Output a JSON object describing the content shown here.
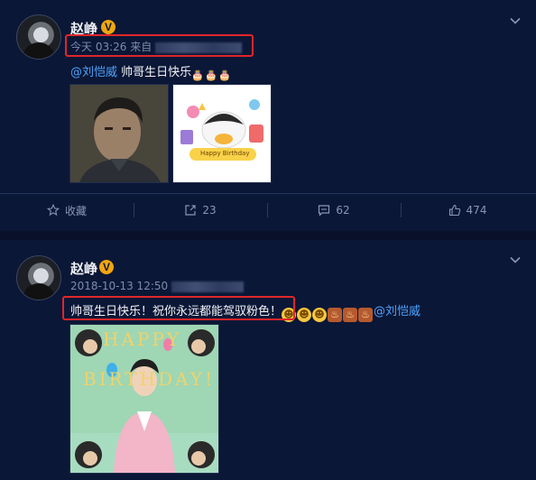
{
  "posts": [
    {
      "username": "赵峥",
      "verified_badge": "V",
      "time": "今天 03:26",
      "source_prefix": "来自",
      "text": "帅哥生日快乐",
      "mention": "@刘恺威",
      "emojis": [
        "cake",
        "cake",
        "cake"
      ],
      "images": [
        "portrait-photo",
        "happy-birthday-cartoon"
      ],
      "image_caption": "Happy Birthday",
      "actions": {
        "favorite": "收藏",
        "share_count": "23",
        "comment_count": "62",
        "like_count": "474"
      }
    },
    {
      "username": "赵峥",
      "verified_badge": "V",
      "time": "2018-10-13 12:50",
      "text": "帅哥生日快乐！祝你永远都能驾驭粉色！",
      "emojis": [
        "grin",
        "grin",
        "grin",
        "cake",
        "cake",
        "cake"
      ],
      "mention": "@刘恺威",
      "images": [
        "happy-birthday-collage"
      ],
      "collage_text": {
        "line1": "HAPPY",
        "line2": "BIRTHDAY!"
      }
    }
  ],
  "colors": {
    "background": "#0b1736",
    "link": "#4da3ff",
    "highlight_box": "#e0262a",
    "verified": "#f2a60c"
  }
}
